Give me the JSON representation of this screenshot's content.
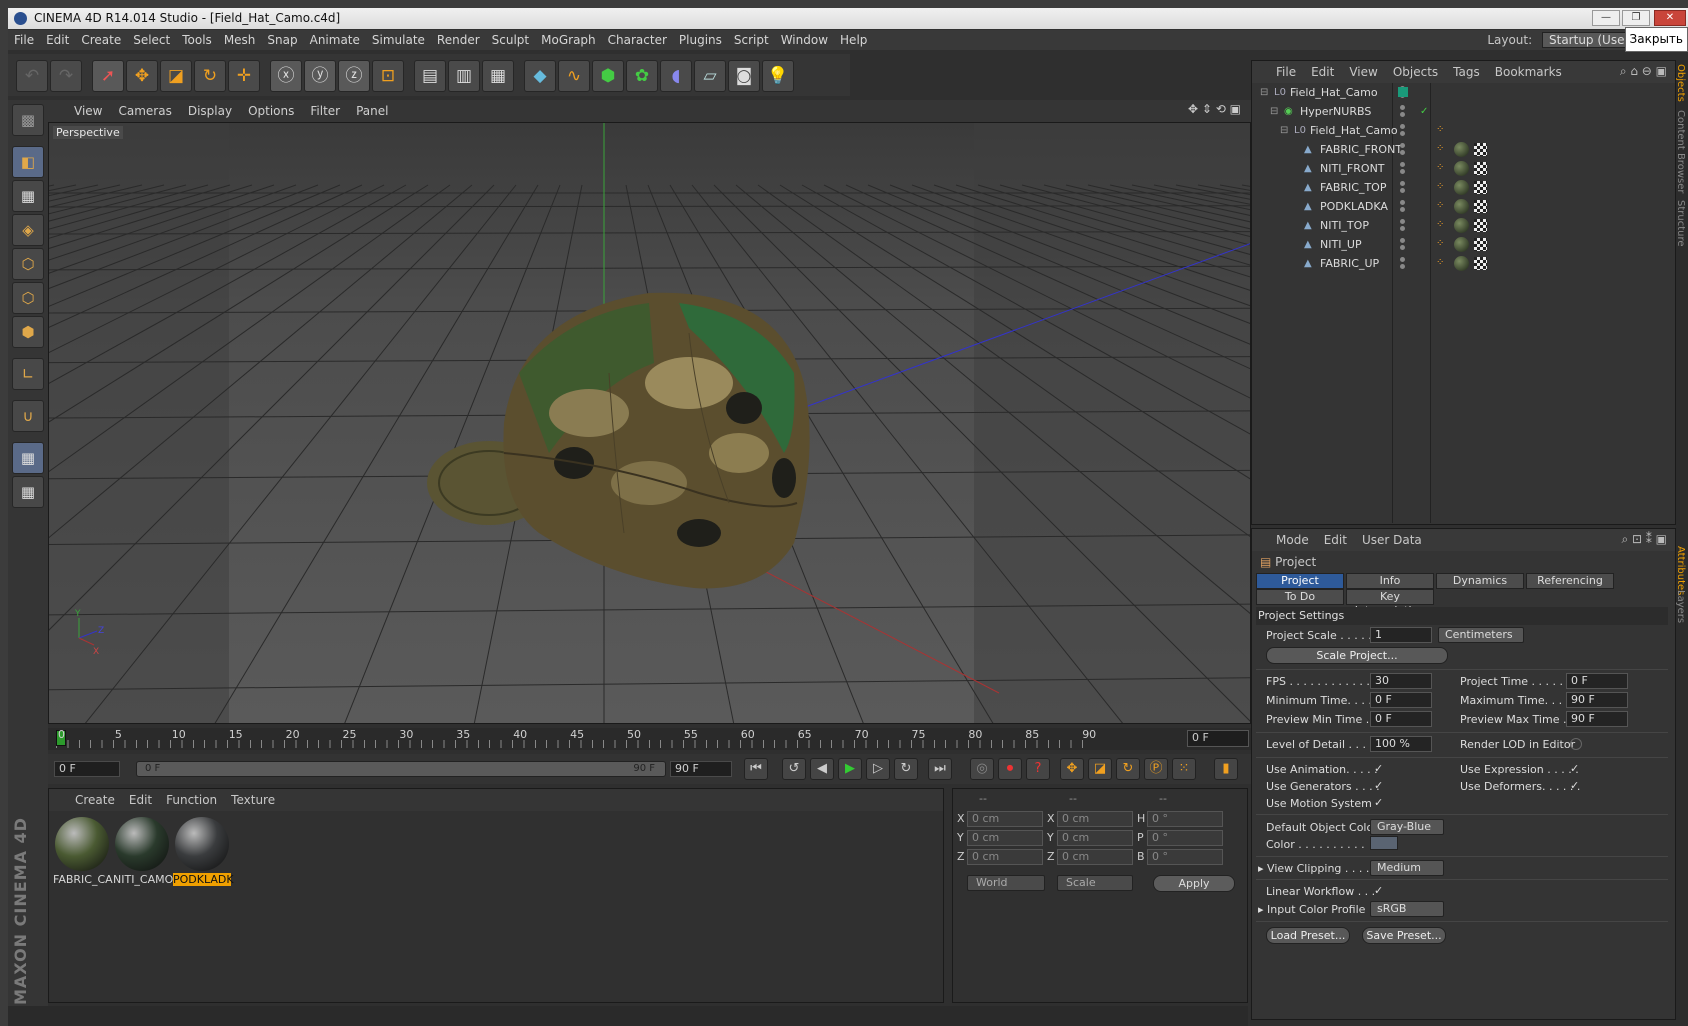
{
  "window": {
    "title": "CINEMA 4D R14.014 Studio - [Field_Hat_Camo.c4d]",
    "tooltip": "Закрыть"
  },
  "menu": [
    "File",
    "Edit",
    "Create",
    "Select",
    "Tools",
    "Mesh",
    "Snap",
    "Animate",
    "Simulate",
    "Render",
    "Sculpt",
    "MoGraph",
    "Character",
    "Plugins",
    "Script",
    "Window",
    "Help"
  ],
  "layout": {
    "label": "Layout:",
    "value": "Startup (User)"
  },
  "viewport": {
    "menu": [
      "View",
      "Cameras",
      "Display",
      "Options",
      "Filter",
      "Panel"
    ],
    "label": "Perspective"
  },
  "timeline": {
    "ticks": [
      "0",
      "5",
      "10",
      "15",
      "20",
      "25",
      "30",
      "35",
      "40",
      "45",
      "50",
      "55",
      "60",
      "65",
      "70",
      "75",
      "80",
      "85",
      "90"
    ],
    "current": "0 F"
  },
  "transport": {
    "start": "0 F",
    "range_start": "0 F",
    "range_end": "90 F",
    "end": "90 F"
  },
  "materials": {
    "menu": [
      "Create",
      "Edit",
      "Function",
      "Texture"
    ],
    "items": [
      {
        "name": "FABRIC_CA",
        "color": "#4a5a32",
        "selected": false
      },
      {
        "name": "NITI_CAMO",
        "color": "#2a3a2c",
        "selected": false
      },
      {
        "name": "PODKLADK",
        "color": "#3a3c3e",
        "selected": true
      }
    ]
  },
  "coords": {
    "header": [
      "--",
      "--",
      "--"
    ],
    "rows": [
      {
        "a": "X",
        "av": "0 cm",
        "b": "X",
        "bv": "0 cm",
        "c": "H",
        "cv": "0 °"
      },
      {
        "a": "Y",
        "av": "0 cm",
        "b": "Y",
        "bv": "0 cm",
        "c": "P",
        "cv": "0 °"
      },
      {
        "a": "Z",
        "av": "0 cm",
        "b": "Z",
        "bv": "0 cm",
        "c": "B",
        "cv": "0 °"
      }
    ],
    "space": "World",
    "mode": "Scale",
    "apply": "Apply"
  },
  "objects": {
    "menu": [
      "File",
      "Edit",
      "View",
      "Objects",
      "Tags",
      "Bookmarks"
    ],
    "rows": [
      {
        "name": "Field_Hat_Camo",
        "indent": 0,
        "type": "null"
      },
      {
        "name": "HyperNURBS",
        "indent": 1,
        "type": "nurbs"
      },
      {
        "name": "Field_Hat_Camo",
        "indent": 2,
        "type": "null"
      },
      {
        "name": "FABRIC_FRONT",
        "indent": 3,
        "type": "poly"
      },
      {
        "name": "NITI_FRONT",
        "indent": 3,
        "type": "poly"
      },
      {
        "name": "FABRIC_TOP",
        "indent": 3,
        "type": "poly"
      },
      {
        "name": "PODKLADKA",
        "indent": 3,
        "type": "poly"
      },
      {
        "name": "NITI_TOP",
        "indent": 3,
        "type": "poly"
      },
      {
        "name": "NITI_UP",
        "indent": 3,
        "type": "poly"
      },
      {
        "name": "FABRIC_UP",
        "indent": 3,
        "type": "poly"
      }
    ]
  },
  "side_tabs": [
    "Objects",
    "Content Browser",
    "Structure",
    "Attributes",
    "Layers"
  ],
  "attributes": {
    "menu": [
      "Mode",
      "Edit",
      "User Data"
    ],
    "object": "Project",
    "tabs1": [
      "Project Settings",
      "Info",
      "Dynamics",
      "Referencing"
    ],
    "tabs2": [
      "To Do",
      "Key Interpolation"
    ],
    "section": "Project Settings",
    "project_scale": {
      "label": "Project Scale . . . . . .",
      "value": "1",
      "unit": "Centimeters"
    },
    "scale_btn": "Scale Project...",
    "fps": {
      "label": "FPS . . . . . . . . . . . . . .",
      "value": "30"
    },
    "project_time": {
      "label": "Project Time . . . . . . . .",
      "value": "0 F"
    },
    "min_time": {
      "label": "Minimum Time. . . . .",
      "value": "0 F"
    },
    "max_time": {
      "label": "Maximum Time. . . . .",
      "value": "90 F"
    },
    "prev_min": {
      "label": "Preview Min Time . . .",
      "value": "0 F"
    },
    "prev_max": {
      "label": "Preview Max Time . . .",
      "value": "90 F"
    },
    "lod": {
      "label": "Level of Detail . . . . .",
      "value": "100 %"
    },
    "render_lod": "Render LOD in Editor",
    "use_anim": "Use Animation. . . . .",
    "use_expr": "Use Expression . . . . .",
    "use_gen": "Use Generators . . . .",
    "use_def": "Use Deformers. . . . . .",
    "use_motion": "Use Motion System",
    "def_color": {
      "label": "Default Object Color",
      "value": "Gray-Blue"
    },
    "color": {
      "label": "Color . . . . . . . . . .",
      "swatch": "#5a6472"
    },
    "clipping": {
      "label": "View Clipping . . . . .",
      "value": "Medium"
    },
    "linear": "Linear Workflow . . .",
    "input_profile": {
      "label": "Input Color Profile .",
      "value": "sRGB"
    },
    "load": "Load Preset...",
    "save": "Save Preset..."
  }
}
